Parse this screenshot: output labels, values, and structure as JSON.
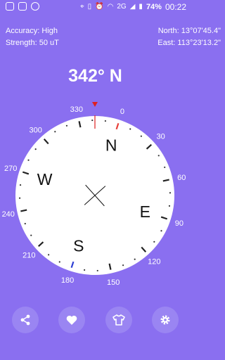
{
  "status_bar": {
    "battery": "74%",
    "time": "00:22",
    "network": "2G",
    "icons": [
      "notification-icon",
      "app-icon",
      "circle-icon",
      "location-icon",
      "vibrate-icon",
      "alarm-icon",
      "wifi-icon",
      "signal-icon",
      "battery-icon"
    ]
  },
  "info": {
    "accuracy": "Accuracy: High",
    "strength": "Strength: 50 uT",
    "north": "North: 13°07'45.4\"",
    "east": "East: 113°23'13.2\""
  },
  "heading": "342° N",
  "compass": {
    "heading_degrees": 342,
    "cardinals": [
      {
        "label": "N",
        "bearing": 0
      },
      {
        "label": "E",
        "bearing": 90
      },
      {
        "label": "S",
        "bearing": 180
      },
      {
        "label": "W",
        "bearing": 270
      }
    ],
    "degree_labels": [
      "0",
      "30",
      "60",
      "90",
      "120",
      "150",
      "180",
      "210",
      "240",
      "270",
      "300",
      "330"
    ],
    "north_marker_color": "#E8403A",
    "south_marker_color": "#2D3FD4",
    "pointer_color": "#E02020"
  },
  "toolbar": {
    "buttons": [
      {
        "name": "share-button",
        "icon": "share-icon"
      },
      {
        "name": "favorite-button",
        "icon": "heart-icon"
      },
      {
        "name": "theme-button",
        "icon": "shirt-icon"
      },
      {
        "name": "settings-button",
        "icon": "gear-icon"
      }
    ]
  },
  "colors": {
    "background": "#8A6FF0",
    "dial": "#FFFFFF",
    "button": "#9A85F2"
  }
}
